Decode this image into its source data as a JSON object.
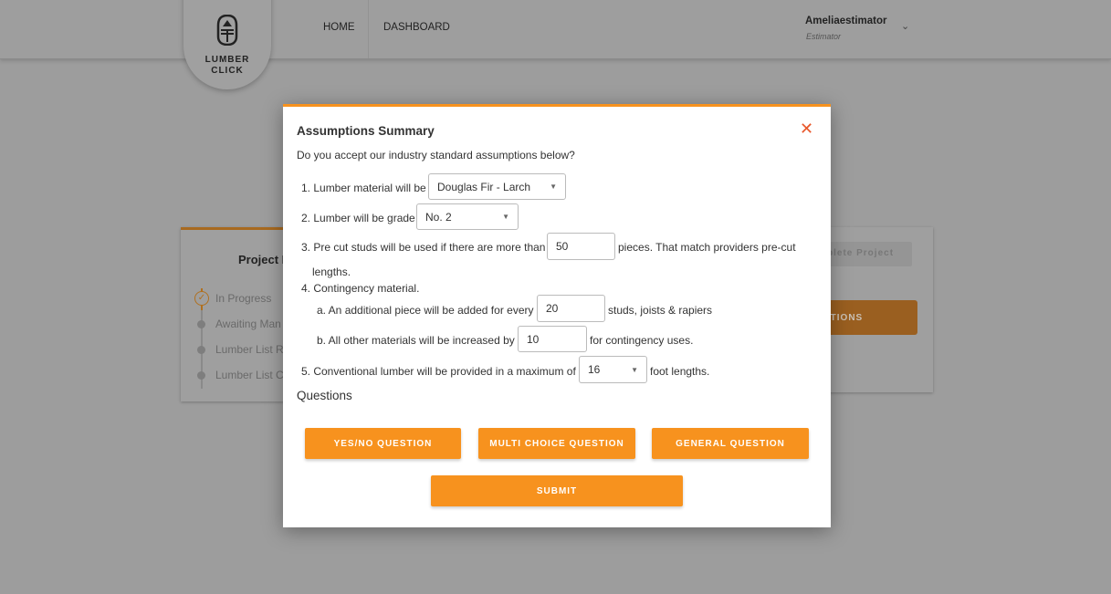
{
  "header": {
    "logo_text": [
      "LUMBER",
      "CLICK"
    ],
    "nav": [
      "HOME",
      "DASHBOARD"
    ],
    "user_name": "Ameliaestimator",
    "user_role": "Estimator"
  },
  "background": {
    "card_title": "Project I",
    "steps": [
      "In Progress",
      "Awaiting Man",
      "Lumber List R",
      "Lumber List C"
    ],
    "complete_button": "plete Project",
    "questions_button": "STIONS"
  },
  "modal": {
    "title": "Assumptions Summary",
    "subtitle": "Do you accept our industry standard assumptions below?",
    "item1": {
      "label": "1. Lumber material will be",
      "value": "Douglas Fir - Larch"
    },
    "item2": {
      "label": "2. Lumber will be grade",
      "value": "No. 2"
    },
    "item3": {
      "label": "3. Pre cut studs will be used if there are more than",
      "value": "50",
      "suffix": "pieces. That match providers pre-cut",
      "suffix2": "lengths."
    },
    "item4": {
      "label": "4. Contingency material.",
      "a": {
        "label": "a. An additional piece will be added for every",
        "value": "20",
        "suffix": "studs, joists & rapiers"
      },
      "b": {
        "label": "b. All other materials will be increased by",
        "value": "10",
        "suffix": "for contingency uses."
      }
    },
    "item5": {
      "label": "5. Conventional lumber will be provided in a maximum of",
      "value": "16",
      "suffix": "foot lengths."
    },
    "questions_heading": "Questions",
    "buttons": {
      "yes_no": "YES/NO QUESTION",
      "multi": "MULTI CHOICE QUESTION",
      "general": "GENERAL QUESTION",
      "submit": "SUBMIT"
    },
    "close_icon": "close-icon"
  },
  "colors": {
    "accent": "#f7921e",
    "close": "#e8572a"
  }
}
